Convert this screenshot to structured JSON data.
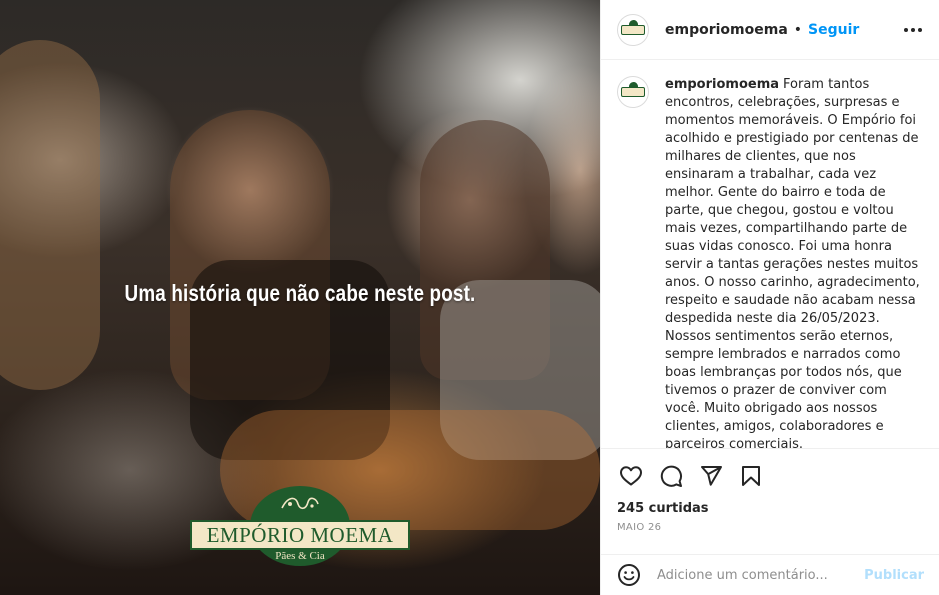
{
  "media": {
    "headline": "Uma história que não cabe neste post.",
    "logo": {
      "title": "EMPÓRIO MOEMA",
      "subtitle": "Pães & Cia"
    }
  },
  "header": {
    "username": "emporiomoema",
    "separator": "•",
    "follow_label": "Seguir",
    "more_icon": "more-horizontal-icon"
  },
  "caption": {
    "username": "emporiomoema",
    "text": "Foram tantos encontros, celebrações, surpresas e momentos memoráveis. O Empório foi acolhido e prestigiado por centenas de milhares de clientes, que nos ensinaram a trabalhar, cada vez melhor. Gente do bairro e toda de parte, que chegou, gostou e voltou mais vezes, compartilhando parte de suas vidas conosco. Foi uma honra servir a tantas gerações nestes muitos anos. O nosso carinho, agradecimento, respeito e saudade não acabam nessa despedida neste dia 26/05/2023. Nossos sentimentos serão eternos, sempre lembrados e narrados como boas lembranças por todos nós, que tivemos o prazer de conviver com você. Muito obrigado aos nossos clientes, amigos, colaboradores e parceiros comerciais."
  },
  "actions": {
    "icons": [
      "heart-icon",
      "comment-icon",
      "share-icon",
      "bookmark-icon"
    ],
    "likes": "245 curtidas",
    "date": "MAIO 26"
  },
  "comment": {
    "placeholder": "Adicione um comentário...",
    "publish_label": "Publicar",
    "emoji_icon": "emoji-icon"
  },
  "colors": {
    "link_blue": "#0095f6",
    "publish_disabled": "#b2dffc",
    "logo_green": "#1f5b2c",
    "logo_cream": "#f3e7c6"
  }
}
